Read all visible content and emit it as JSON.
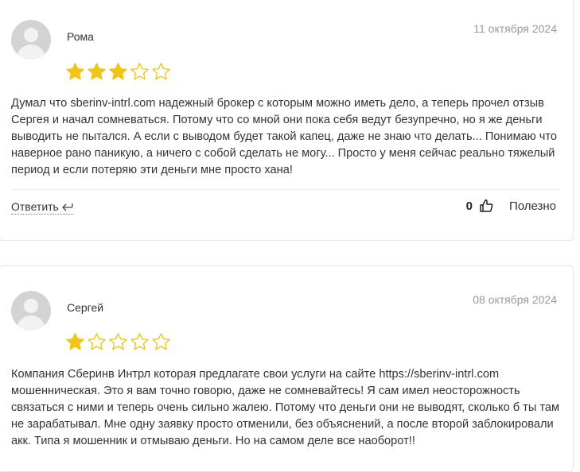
{
  "reviews": [
    {
      "author": "Рома",
      "date": "11 октября 2024",
      "rating": 3,
      "max_rating": 5,
      "text": "Думал что sberinv-intrl.com надежный брокер с которым можно иметь дело, а теперь прочел отзыв Сергея и начал сомневаться. Потому что со мной они пока себя ведут безупречно, но я же деньги выводить не пытался. А если с выводом будет такой капец, даже не знаю что делать... Понимаю что наверное рано паникую, а ничего с собой сделать не могу... Просто у меня сейчас реально тяжелый период и если потеряю эти деньги мне просто хана!",
      "reply_label": "Ответить",
      "likes": "0",
      "useful_label": "Полезно"
    },
    {
      "author": "Сергей",
      "date": "08 октября 2024",
      "rating": 1,
      "max_rating": 5,
      "text": "Компания Сберинв Интрл которая предлагате свои услуги на сайте https://sberinv-intrl.com мошенническая. Это я вам точно говорю, даже не сомневайтесь! Я сам имел неосторожность связаться с ними и теперь очень сильно жалею. Потому что деньги они не выводят, сколько б ты там не зарабатывал. Мне одну заявку просто отменили, без объяснений, а после второй заблокировали акк. Типа я мошенник и отмываю деньги. Но на самом деле все наоборот!!"
    }
  ],
  "colors": {
    "star_filled": "#f0c419",
    "star_empty": "#f0c419",
    "date": "#999999",
    "border": "#e3e3e3"
  },
  "icons": {
    "reply": "reply-arrow-icon",
    "like": "thumbs-up-icon",
    "star": "star-icon"
  }
}
